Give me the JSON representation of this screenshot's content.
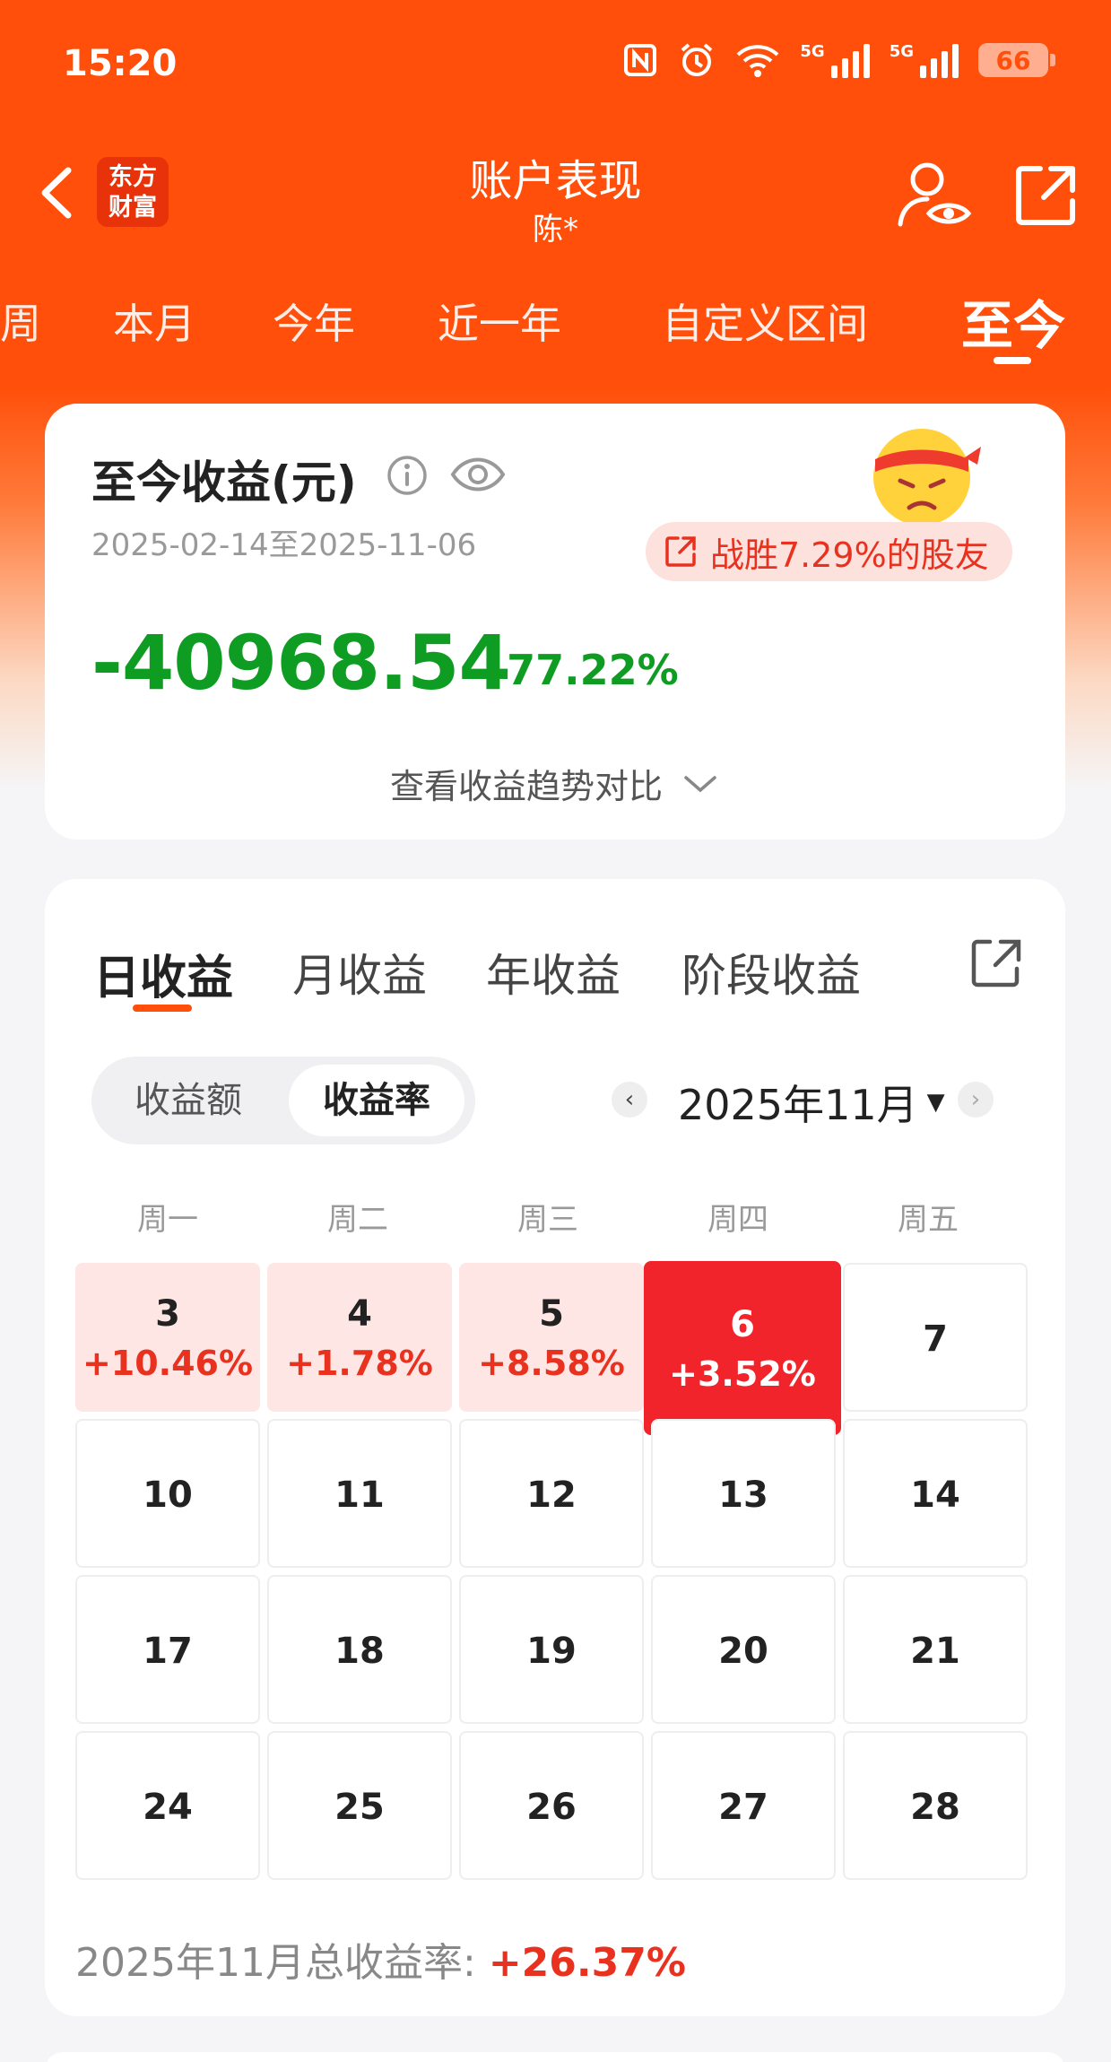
{
  "status_bar": {
    "time": "15:20",
    "signal_label_1": "5G",
    "signal_label_2": "5G",
    "battery": "66"
  },
  "nav": {
    "title": "账户表现",
    "subtitle": "陈*",
    "logo_line1": "东方",
    "logo_line2": "财富"
  },
  "period_tabs": [
    {
      "label": "周"
    },
    {
      "label": "本月"
    },
    {
      "label": "今年"
    },
    {
      "label": "近一年"
    },
    {
      "label": "自定义区间"
    },
    {
      "label": "至今"
    }
  ],
  "summary_card": {
    "title": "至今收益(元)",
    "date_range": "2025-02-14至2025-11-06",
    "beat_text": "战胜7.29%的股友",
    "profit": "-40968.54",
    "profit_pct": "-77.22%",
    "trend_link": "查看收益趋势对比"
  },
  "calendar_card": {
    "tabs": [
      {
        "label": "日收益"
      },
      {
        "label": "月收益"
      },
      {
        "label": "年收益"
      },
      {
        "label": "阶段收益"
      }
    ],
    "toggle": {
      "amount": "收益额",
      "rate": "收益率"
    },
    "month": "2025年11月",
    "weekdays": [
      "周一",
      "周二",
      "周三",
      "周四",
      "周五"
    ],
    "rows": [
      [
        {
          "day": "3",
          "value": "+10.46%"
        },
        {
          "day": "4",
          "value": "+1.78%"
        },
        {
          "day": "5",
          "value": "+8.58%"
        },
        {
          "day": "6",
          "value": "+3.52%"
        },
        {
          "day": "7",
          "value": ""
        }
      ],
      [
        {
          "day": "10",
          "value": ""
        },
        {
          "day": "11",
          "value": ""
        },
        {
          "day": "12",
          "value": ""
        },
        {
          "day": "13",
          "value": ""
        },
        {
          "day": "14",
          "value": ""
        }
      ],
      [
        {
          "day": "17",
          "value": ""
        },
        {
          "day": "18",
          "value": ""
        },
        {
          "day": "19",
          "value": ""
        },
        {
          "day": "20",
          "value": ""
        },
        {
          "day": "21",
          "value": ""
        }
      ],
      [
        {
          "day": "24",
          "value": ""
        },
        {
          "day": "25",
          "value": ""
        },
        {
          "day": "26",
          "value": ""
        },
        {
          "day": "27",
          "value": ""
        },
        {
          "day": "28",
          "value": ""
        }
      ]
    ],
    "summary_label": "2025年11月总收益率: ",
    "summary_value": "+26.37%"
  },
  "colors": {
    "brand": "#ff4f0a",
    "loss": "#0e9d22",
    "gain": "#e8321f",
    "today": "#f0242a"
  }
}
